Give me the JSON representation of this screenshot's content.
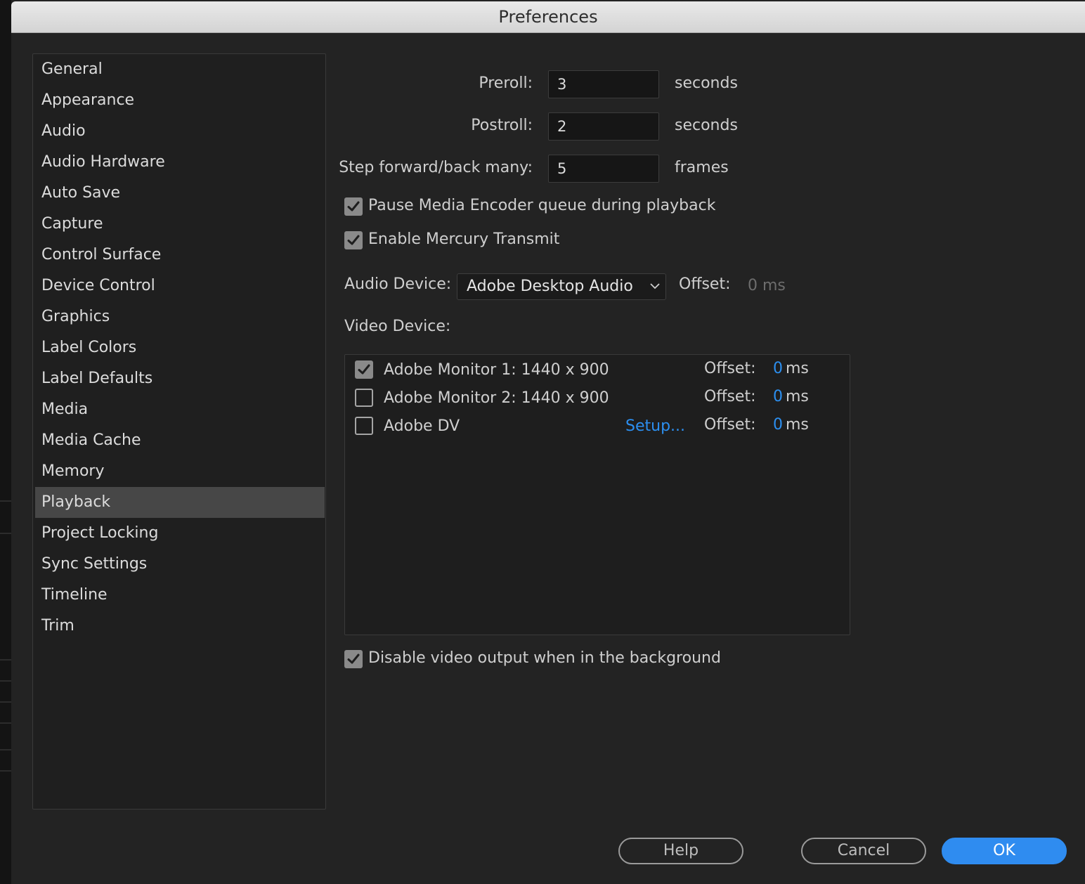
{
  "window": {
    "title": "Preferences"
  },
  "sidebar": {
    "items": [
      {
        "label": "General",
        "active": false
      },
      {
        "label": "Appearance",
        "active": false
      },
      {
        "label": "Audio",
        "active": false
      },
      {
        "label": "Audio Hardware",
        "active": false
      },
      {
        "label": "Auto Save",
        "active": false
      },
      {
        "label": "Capture",
        "active": false
      },
      {
        "label": "Control Surface",
        "active": false
      },
      {
        "label": "Device Control",
        "active": false
      },
      {
        "label": "Graphics",
        "active": false
      },
      {
        "label": "Label Colors",
        "active": false
      },
      {
        "label": "Label Defaults",
        "active": false
      },
      {
        "label": "Media",
        "active": false
      },
      {
        "label": "Media Cache",
        "active": false
      },
      {
        "label": "Memory",
        "active": false
      },
      {
        "label": "Playback",
        "active": true
      },
      {
        "label": "Project Locking",
        "active": false
      },
      {
        "label": "Sync Settings",
        "active": false
      },
      {
        "label": "Timeline",
        "active": false
      },
      {
        "label": "Trim",
        "active": false
      }
    ]
  },
  "playback": {
    "preroll": {
      "label": "Preroll:",
      "value": "3",
      "unit": "seconds"
    },
    "postroll": {
      "label": "Postroll:",
      "value": "2",
      "unit": "seconds"
    },
    "step": {
      "label": "Step forward/back many:",
      "value": "5",
      "unit": "frames"
    },
    "pause_encoder": {
      "label": "Pause Media Encoder queue during playback",
      "checked": true
    },
    "mercury": {
      "label": "Enable Mercury Transmit",
      "checked": true
    },
    "audio_device": {
      "label": "Audio Device:",
      "value": "Adobe Desktop Audio",
      "offset_label": "Offset:",
      "offset_value": "0 ms"
    },
    "video_device": {
      "label": "Video Device:",
      "devices": [
        {
          "name": "Adobe Monitor 1: 1440 x 900",
          "checked": true,
          "setup": "",
          "offset_label": "Offset:",
          "offset_value": "0",
          "offset_unit": "ms"
        },
        {
          "name": "Adobe Monitor 2: 1440 x 900",
          "checked": false,
          "setup": "",
          "offset_label": "Offset:",
          "offset_value": "0",
          "offset_unit": "ms"
        },
        {
          "name": "Adobe DV",
          "checked": false,
          "setup": "Setup...",
          "offset_label": "Offset:",
          "offset_value": "0",
          "offset_unit": "ms"
        }
      ]
    },
    "disable_background": {
      "label": "Disable video output when in the background",
      "checked": true
    }
  },
  "buttons": {
    "help": "Help",
    "cancel": "Cancel",
    "ok": "OK"
  },
  "colors": {
    "accent": "#2f8cf0",
    "link": "#2c8ff0",
    "active_item": "#474747",
    "dialog_bg": "#232323"
  }
}
